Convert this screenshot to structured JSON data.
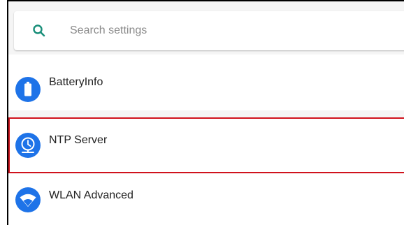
{
  "search": {
    "placeholder": "Search settings",
    "icon": "search-icon"
  },
  "settings_items": [
    {
      "label": "BatteryInfo",
      "icon": "battery-icon",
      "highlighted": false
    },
    {
      "label": "NTP Server",
      "icon": "clock-server-icon",
      "highlighted": true
    },
    {
      "label": "WLAN Advanced",
      "icon": "wifi-icon",
      "highlighted": false
    }
  ],
  "colors": {
    "accent": "#1a8f7a",
    "icon_background": "#1e73e8",
    "highlight_border": "#d0121c",
    "background": "#f5f5f5"
  }
}
